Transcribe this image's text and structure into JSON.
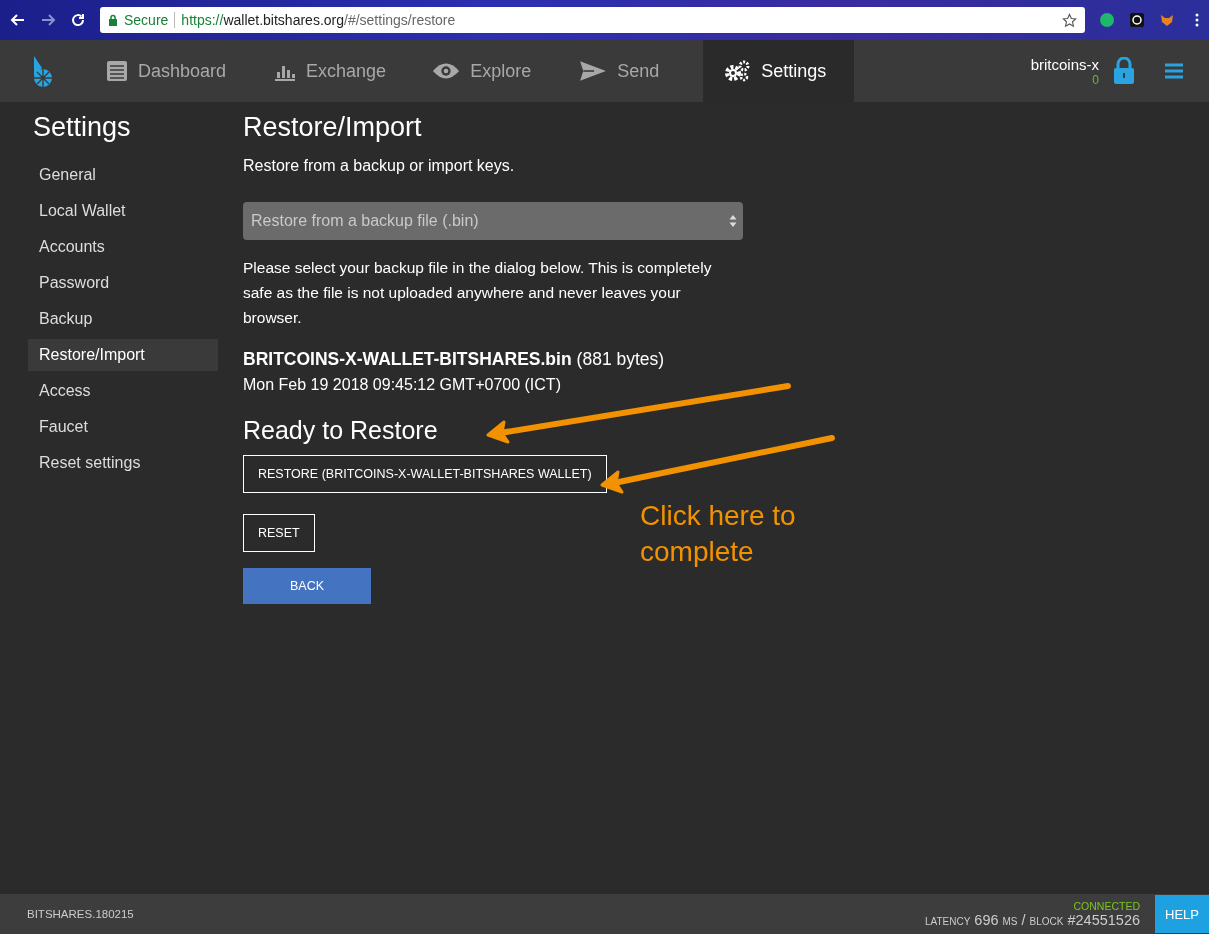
{
  "browser": {
    "secure_label": "Secure",
    "url_scheme": "https://",
    "url_host": "wallet.bitshares.org",
    "url_path": "/#/settings/restore"
  },
  "nav": {
    "tabs": [
      {
        "kind": "dashboard",
        "label": "Dashboard",
        "selected": false
      },
      {
        "kind": "exchange",
        "label": "Exchange",
        "selected": false
      },
      {
        "kind": "explore",
        "label": "Explore",
        "selected": false
      },
      {
        "kind": "send",
        "label": "Send",
        "selected": false
      },
      {
        "kind": "settings",
        "label": "Settings",
        "selected": true
      }
    ],
    "account": {
      "name": "britcoins-x",
      "balance": "0"
    }
  },
  "sidebar": {
    "title": "Settings",
    "items": [
      {
        "label": "General",
        "selected": false
      },
      {
        "label": "Local Wallet",
        "selected": false
      },
      {
        "label": "Accounts",
        "selected": false
      },
      {
        "label": "Password",
        "selected": false
      },
      {
        "label": "Backup",
        "selected": false
      },
      {
        "label": "Restore/Import",
        "selected": true
      },
      {
        "label": "Access",
        "selected": false
      },
      {
        "label": "Faucet",
        "selected": false
      },
      {
        "label": "Reset settings",
        "selected": false
      }
    ]
  },
  "content": {
    "title": "Restore/Import",
    "subtitle": "Restore from a backup or import keys.",
    "restore_type": "Restore from a backup file (.bin)",
    "instructions": "Please select your backup file in the dialog below. This is completely safe as the file is not uploaded anywhere and never leaves your browser.",
    "file_name": "BRITCOINS-X-WALLET-BITSHARES.bin",
    "file_size": "(881 bytes)",
    "file_date": "Mon Feb 19 2018 09:45:12 GMT+0700 (ICT)",
    "ready_heading": "Ready to Restore",
    "buttons": [
      {
        "kind": "outline",
        "label": "RESTORE (BRITCOINS-X-WALLET-BITSHARES WALLET)"
      },
      {
        "kind": "outline",
        "label": "RESET"
      },
      {
        "kind": "primary",
        "label": "BACK"
      }
    ]
  },
  "annotation": {
    "text": "Click here to complete"
  },
  "footer": {
    "version": "BITSHARES.180215",
    "status": "CONNECTED",
    "latency_label": "LATENCY",
    "latency_value": "696",
    "latency_unit": "MS",
    "separator": "/",
    "block_label": "BLOCK",
    "block_value": "#24551526",
    "help": "HELP"
  }
}
